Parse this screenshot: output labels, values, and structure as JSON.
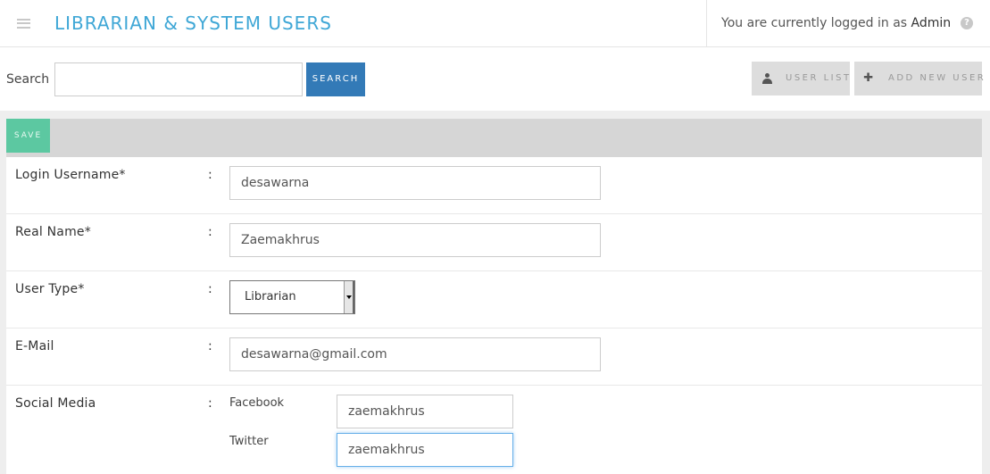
{
  "header": {
    "title": "LIBRARIAN & SYSTEM USERS",
    "login_prefix": "You are currently logged in as",
    "login_user": "Admin",
    "help_glyph": "?",
    "menu_icon": "hamburger-icon",
    "help_icon": "question-circle-icon"
  },
  "search": {
    "label": "Search :",
    "value": "",
    "button_label": "SEARCH"
  },
  "toolbar": {
    "user_list_label": "USER LIST",
    "user_list_icon": "user-icon",
    "add_new_label": "ADD NEW USER",
    "add_new_glyph": "✚",
    "add_new_icon": "plus-icon"
  },
  "form": {
    "save_label": "SAVE",
    "colon": ":",
    "fields": [
      {
        "label": "Login Username*",
        "value": "desawarna"
      },
      {
        "label": "Real Name*",
        "value": "Zaemakhrus"
      },
      {
        "label": "User Type*",
        "value": "Librarian"
      },
      {
        "label": "E-Mail",
        "value": "desawarna@gmail.com"
      }
    ],
    "social": {
      "label": "Social Media",
      "items": [
        {
          "label": "Facebook",
          "value": "zaemakhrus"
        },
        {
          "label": "Twitter",
          "value": "zaemakhrus"
        }
      ]
    }
  },
  "colors": {
    "title": "#3fa7d6",
    "search_button": "#337ab7",
    "save_button": "#5cc8a1",
    "tool_button_bg": "#dddddd"
  }
}
